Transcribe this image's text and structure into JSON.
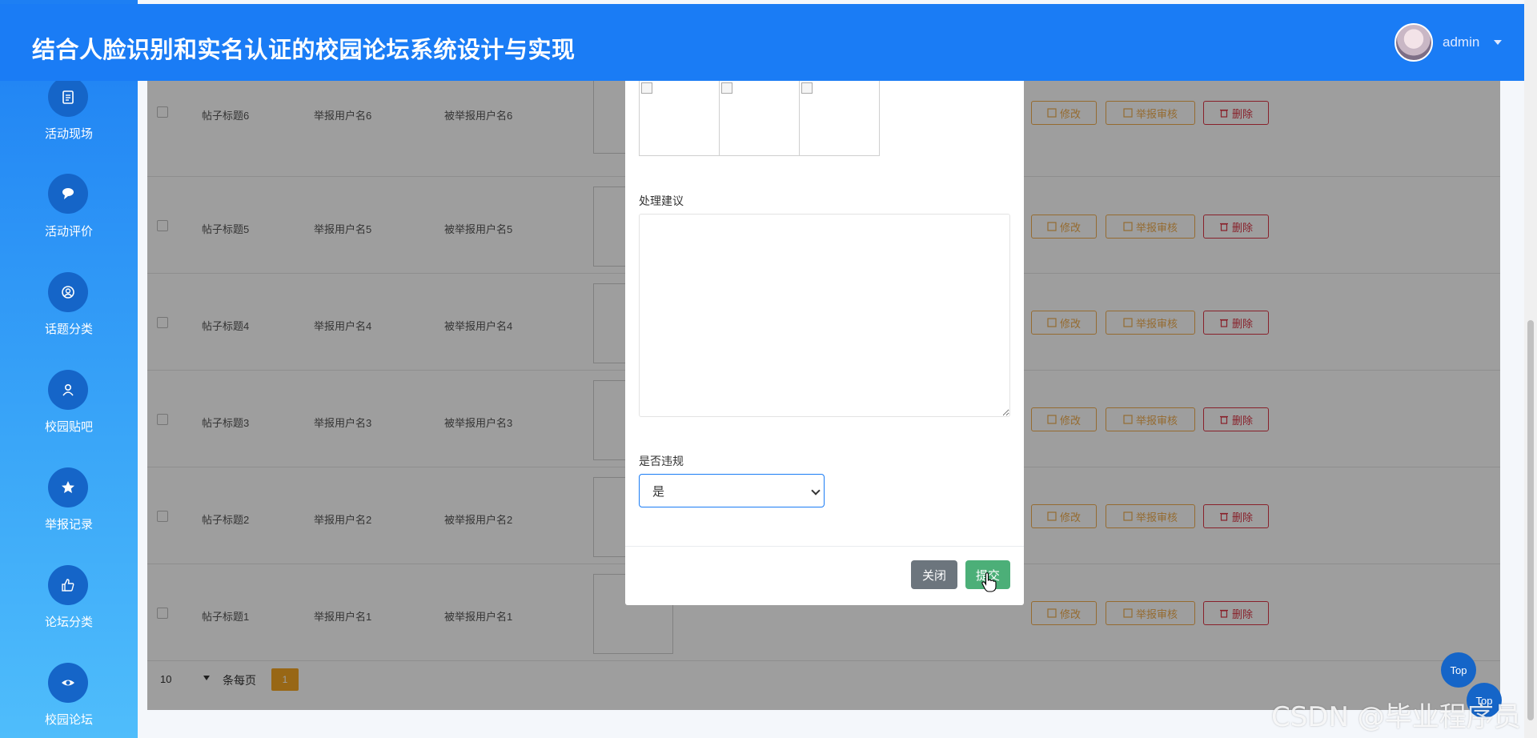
{
  "header": {
    "title": "结合人脸识别和实名认证的校园论坛系统设计与实现",
    "username": "admin"
  },
  "sidebar": {
    "items": [
      {
        "label": "活动现场",
        "icon": "calendar-icon"
      },
      {
        "label": "活动评价",
        "icon": "chat-icon"
      },
      {
        "label": "话题分类",
        "icon": "circle-user-icon"
      },
      {
        "label": "校园贴吧",
        "icon": "user-icon"
      },
      {
        "label": "举报记录",
        "icon": "star-icon"
      },
      {
        "label": "论坛分类",
        "icon": "thumbs-up-icon"
      },
      {
        "label": "校园论坛",
        "icon": "eye-icon"
      }
    ]
  },
  "table": {
    "rows": [
      {
        "title": "帖子标题6",
        "reporter": "举报用户名6",
        "reported": "被举报用户名6"
      },
      {
        "title": "帖子标题5",
        "reporter": "举报用户名5",
        "reported": "被举报用户名5"
      },
      {
        "title": "帖子标题4",
        "reporter": "举报用户名4",
        "reported": "被举报用户名4"
      },
      {
        "title": "帖子标题3",
        "reporter": "举报用户名3",
        "reported": "被举报用户名3"
      },
      {
        "title": "帖子标题2",
        "reporter": "举报用户名2",
        "reported": "被举报用户名2"
      },
      {
        "title": "帖子标题1",
        "reporter": "举报用户名1",
        "reported": "被举报用户名1"
      }
    ],
    "actions": {
      "edit": "修改",
      "audit": "举报审核",
      "delete": "删除"
    }
  },
  "pager": {
    "per_page": "10",
    "per_page_label": "条每页",
    "current_page": "1"
  },
  "modal": {
    "suggestion_label": "处理建议",
    "suggestion_value": "",
    "violation_label": "是否违规",
    "violation_value": "是",
    "close_label": "关闭",
    "submit_label": "提交"
  },
  "top_button": "Top",
  "watermark": "CSDN @毕业程序员",
  "colors": {
    "primary": "#1a7cf5",
    "warning": "#f0ad4e",
    "danger": "#dc3545",
    "success": "#4caf78",
    "secondary": "#6c757d"
  }
}
